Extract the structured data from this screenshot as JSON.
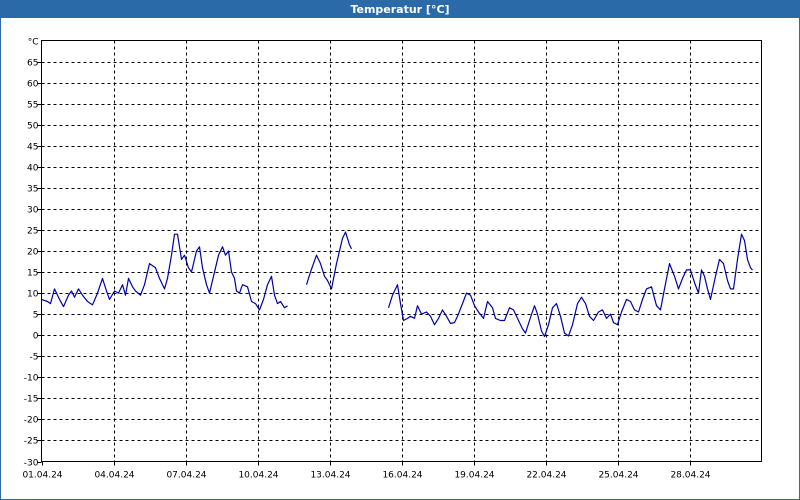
{
  "window": {
    "title": "Temperatur [°C]"
  },
  "chart_data": {
    "type": "line",
    "title": "Temperatur [°C]",
    "ylabel": "°C",
    "xlabel": "",
    "ylim": [
      -30,
      70
    ],
    "yticks": [
      -30,
      -25,
      -20,
      -15,
      -10,
      -5,
      0,
      5,
      10,
      15,
      20,
      25,
      30,
      35,
      40,
      45,
      50,
      55,
      60,
      65
    ],
    "xlim": [
      "2024-04-01",
      "2024-05-01"
    ],
    "xticks": [
      "01.04.24",
      "04.04.24",
      "07.04.24",
      "10.04.24",
      "13.04.24",
      "16.04.24",
      "19.04.24",
      "22.04.24",
      "25.04.24",
      "28.04.24"
    ],
    "grid": true,
    "series": [
      {
        "color": "#0000aa",
        "segments": [
          [
            [
              "2024-04-01 00:00",
              8.5
            ],
            [
              "2024-04-01 06:00",
              8.0
            ],
            [
              "2024-04-01 09:00",
              7.5
            ],
            [
              "2024-04-01 13:00",
              11.0
            ],
            [
              "2024-04-01 18:00",
              8.5
            ],
            [
              "2024-04-01 22:00",
              6.8
            ],
            [
              "2024-04-02 03:00",
              9.5
            ],
            [
              "2024-04-02 06:00",
              10.5
            ],
            [
              "2024-04-02 09:00",
              9.0
            ],
            [
              "2024-04-02 13:00",
              11.0
            ],
            [
              "2024-04-02 17:00",
              9.5
            ],
            [
              "2024-04-02 22:00",
              8.0
            ],
            [
              "2024-04-03 03:00",
              7.2
            ],
            [
              "2024-04-03 08:00",
              10.0
            ],
            [
              "2024-04-03 13:00",
              13.5
            ],
            [
              "2024-04-03 17:00",
              10.5
            ],
            [
              "2024-04-03 20:00",
              8.5
            ],
            [
              "2024-04-04 01:00",
              10.5
            ],
            [
              "2024-04-04 05:00",
              10.0
            ],
            [
              "2024-04-04 09:00",
              12.0
            ],
            [
              "2024-04-04 12:00",
              9.5
            ],
            [
              "2024-04-04 15:00",
              13.5
            ],
            [
              "2024-04-04 19:00",
              11.5
            ],
            [
              "2024-04-04 22:00",
              10.5
            ],
            [
              "2024-04-05 03:00",
              9.5
            ],
            [
              "2024-04-05 07:00",
              12.0
            ],
            [
              "2024-04-05 12:00",
              17.0
            ],
            [
              "2024-04-05 18:00",
              16.0
            ],
            [
              "2024-04-05 22:00",
              13.5
            ],
            [
              "2024-04-06 03:00",
              11.0
            ],
            [
              "2024-04-06 06:00",
              13.5
            ],
            [
              "2024-04-06 10:00",
              19.0
            ],
            [
              "2024-04-06 13:00",
              24.0
            ],
            [
              "2024-04-06 16:00",
              24.0
            ],
            [
              "2024-04-06 18:00",
              21.0
            ],
            [
              "2024-04-06 20:00",
              18.0
            ],
            [
              "2024-04-06 23:00",
              19.0
            ],
            [
              "2024-04-07 03:00",
              16.0
            ],
            [
              "2024-04-07 06:00",
              15.0
            ],
            [
              "2024-04-07 11:00",
              20.0
            ],
            [
              "2024-04-07 14:00",
              21.0
            ],
            [
              "2024-04-07 17:00",
              16.0
            ],
            [
              "2024-04-07 21:00",
              12.0
            ],
            [
              "2024-04-08 00:00",
              10.0
            ],
            [
              "2024-04-08 04:00",
              14.0
            ],
            [
              "2024-04-08 09:00",
              19.0
            ],
            [
              "2024-04-08 13:00",
              21.0
            ],
            [
              "2024-04-08 16:00",
              19.0
            ],
            [
              "2024-04-08 19:00",
              20.0
            ],
            [
              "2024-04-08 22:00",
              15.0
            ],
            [
              "2024-04-09 01:00",
              13.5
            ],
            [
              "2024-04-09 03:00",
              10.5
            ],
            [
              "2024-04-09 06:00",
              10.0
            ],
            [
              "2024-04-09 09:00",
              12.0
            ],
            [
              "2024-04-09 14:00",
              11.5
            ],
            [
              "2024-04-09 18:00",
              8.0
            ],
            [
              "2024-04-09 22:00",
              7.5
            ],
            [
              "2024-04-10 02:00",
              6.0
            ],
            [
              "2024-04-10 06:00",
              8.5
            ],
            [
              "2024-04-10 10:00",
              12.0
            ],
            [
              "2024-04-10 14:00",
              14.0
            ],
            [
              "2024-04-10 17:00",
              9.5
            ],
            [
              "2024-04-10 20:00",
              7.5
            ],
            [
              "2024-04-10 23:00",
              8.0
            ],
            [
              "2024-04-11 03:00",
              6.5
            ],
            [
              "2024-04-11 06:00",
              7.0
            ]
          ],
          [
            [
              "2024-04-12 01:00",
              12.0
            ],
            [
              "2024-04-12 05:00",
              15.0
            ],
            [
              "2024-04-12 11:00",
              19.0
            ],
            [
              "2024-04-12 15:00",
              17.0
            ],
            [
              "2024-04-12 19:00",
              14.0
            ],
            [
              "2024-04-12 22:00",
              13.0
            ],
            [
              "2024-04-13 02:00",
              11.0
            ],
            [
              "2024-04-13 07:00",
              17.0
            ],
            [
              "2024-04-13 13:00",
              23.0
            ],
            [
              "2024-04-13 16:00",
              24.5
            ],
            [
              "2024-04-13 20:00",
              21.5
            ],
            [
              "2024-04-13 22:00",
              20.5
            ]
          ],
          [
            [
              "2024-04-15 11:00",
              6.5
            ],
            [
              "2024-04-15 15:00",
              9.5
            ],
            [
              "2024-04-15 20:00",
              12.0
            ],
            [
              "2024-04-15 23:00",
              7.5
            ],
            [
              "2024-04-16 02:00",
              3.5
            ],
            [
              "2024-04-16 06:00",
              4.0
            ],
            [
              "2024-04-16 09:00",
              4.5
            ],
            [
              "2024-04-16 13:00",
              4.0
            ],
            [
              "2024-04-16 16:00",
              7.0
            ],
            [
              "2024-04-16 20:00",
              5.0
            ],
            [
              "2024-04-17 01:00",
              5.5
            ],
            [
              "2024-04-17 05:00",
              4.5
            ],
            [
              "2024-04-17 09:00",
              2.5
            ],
            [
              "2024-04-17 13:00",
              4.0
            ],
            [
              "2024-04-17 17:00",
              6.0
            ],
            [
              "2024-04-17 21:00",
              4.5
            ],
            [
              "2024-04-18 01:00",
              2.8
            ],
            [
              "2024-04-18 05:00",
              3.0
            ],
            [
              "2024-04-18 08:00",
              4.5
            ],
            [
              "2024-04-18 13:00",
              7.5
            ],
            [
              "2024-04-18 17:00",
              10.0
            ],
            [
              "2024-04-18 21:00",
              9.5
            ],
            [
              "2024-04-19 01:00",
              7.0
            ],
            [
              "2024-04-19 05:00",
              5.5
            ],
            [
              "2024-04-19 10:00",
              4.0
            ],
            [
              "2024-04-19 14:00",
              8.0
            ],
            [
              "2024-04-19 19:00",
              6.5
            ],
            [
              "2024-04-19 22:00",
              4.0
            ],
            [
              "2024-04-20 03:00",
              3.5
            ],
            [
              "2024-04-20 07:00",
              3.5
            ],
            [
              "2024-04-20 12:00",
              6.5
            ],
            [
              "2024-04-20 16:00",
              6.0
            ],
            [
              "2024-04-20 20:00",
              4.0
            ],
            [
              "2024-04-21 01:00",
              1.5
            ],
            [
              "2024-04-21 04:00",
              0.5
            ],
            [
              "2024-04-21 08:00",
              3.5
            ],
            [
              "2024-04-21 13:00",
              7.0
            ],
            [
              "2024-04-21 16:00",
              5.0
            ],
            [
              "2024-04-21 20:00",
              1.0
            ],
            [
              "2024-04-21 23:00",
              -0.3
            ],
            [
              "2024-04-22 03:00",
              2.5
            ],
            [
              "2024-04-22 07:00",
              6.5
            ],
            [
              "2024-04-22 11:00",
              7.5
            ],
            [
              "2024-04-22 15:00",
              4.5
            ],
            [
              "2024-04-22 19:00",
              0.5
            ],
            [
              "2024-04-22 23:00",
              -0.2
            ],
            [
              "2024-04-23 03:00",
              2.5
            ],
            [
              "2024-04-23 08:00",
              7.5
            ],
            [
              "2024-04-23 12:00",
              9.0
            ],
            [
              "2024-04-23 16:00",
              7.5
            ],
            [
              "2024-04-23 20:00",
              4.5
            ],
            [
              "2024-04-24 00:00",
              3.5
            ],
            [
              "2024-04-24 05:00",
              5.5
            ],
            [
              "2024-04-24 09:00",
              6.0
            ],
            [
              "2024-04-24 13:00",
              4.0
            ],
            [
              "2024-04-24 17:00",
              5.0
            ],
            [
              "2024-04-24 20:00",
              3.0
            ],
            [
              "2024-04-25 00:00",
              2.5
            ],
            [
              "2024-04-25 04:00",
              5.5
            ],
            [
              "2024-04-25 09:00",
              8.5
            ],
            [
              "2024-04-25 13:00",
              8.0
            ],
            [
              "2024-04-25 17:00",
              6.0
            ],
            [
              "2024-04-25 21:00",
              5.5
            ],
            [
              "2024-04-26 01:00",
              8.5
            ],
            [
              "2024-04-26 05:00",
              11.0
            ],
            [
              "2024-04-26 10:00",
              11.5
            ],
            [
              "2024-04-26 15:00",
              7.0
            ],
            [
              "2024-04-26 19:00",
              6.0
            ],
            [
              "2024-04-26 23:00",
              11.0
            ],
            [
              "2024-04-27 04:00",
              17.0
            ],
            [
              "2024-04-27 09:00",
              14.0
            ],
            [
              "2024-04-27 13:00",
              11.0
            ],
            [
              "2024-04-27 17:00",
              13.5
            ],
            [
              "2024-04-27 21:00",
              15.5
            ],
            [
              "2024-04-28 01:00",
              15.5
            ],
            [
              "2024-04-28 05:00",
              12.5
            ],
            [
              "2024-04-28 09:00",
              10.0
            ],
            [
              "2024-04-28 12:00",
              15.5
            ],
            [
              "2024-04-28 15:00",
              14.0
            ],
            [
              "2024-04-28 18:00",
              11.0
            ],
            [
              "2024-04-28 21:00",
              8.5
            ],
            [
              "2024-04-29 02:00",
              14.0
            ],
            [
              "2024-04-29 06:00",
              18.0
            ],
            [
              "2024-04-29 10:00",
              17.0
            ],
            [
              "2024-04-29 14:00",
              13.0
            ],
            [
              "2024-04-29 17:00",
              11.0
            ],
            [
              "2024-04-29 20:00",
              11.0
            ],
            [
              "2024-04-30 00:00",
              18.0
            ],
            [
              "2024-04-30 04:00",
              24.0
            ],
            [
              "2024-04-30 07:00",
              22.5
            ],
            [
              "2024-04-30 10:00",
              18.0
            ],
            [
              "2024-04-30 13:00",
              16.0
            ],
            [
              "2024-04-30 15:00",
              15.5
            ]
          ]
        ]
      }
    ]
  }
}
